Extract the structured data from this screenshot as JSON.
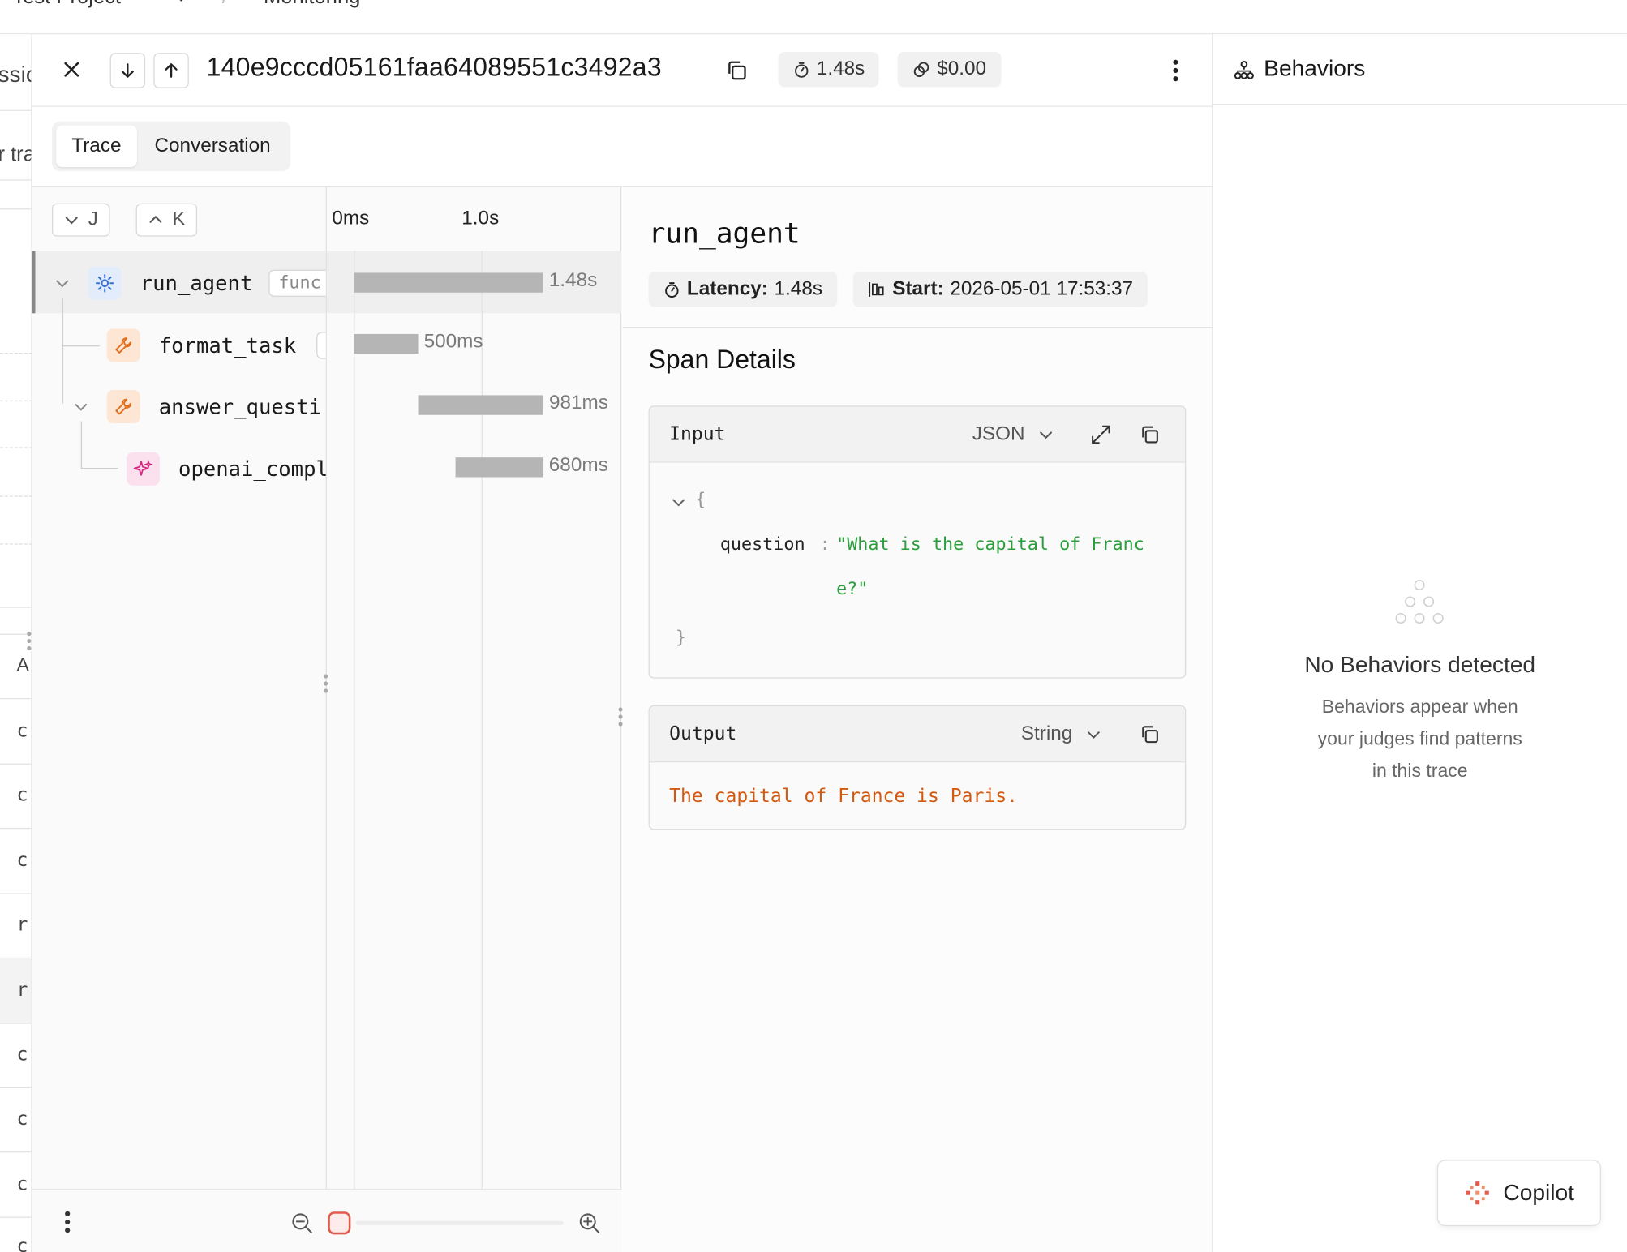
{
  "topbar": {
    "project": "Test Project",
    "separator": "/",
    "page": "Monitoring"
  },
  "left_strip": {
    "fragments": [
      "ssic",
      "r tra",
      "A",
      "c",
      "c",
      "c",
      "r",
      "r",
      "c",
      "c",
      "c",
      "c"
    ]
  },
  "header": {
    "trace_id": "140e9cccd05161faa64089551c3492a3",
    "latency_chip": "1.48s",
    "cost_chip": "$0.00",
    "icons": {
      "close": "close-icon",
      "down": "arrow-down-icon",
      "up": "arrow-up-icon",
      "copy": "copy-icon",
      "more": "more-vertical-icon"
    }
  },
  "tabs": [
    "Trace",
    "Conversation"
  ],
  "tree": {
    "next_key": "J",
    "prev_key": "K",
    "nodes": [
      {
        "name": "run_agent",
        "tag": "func",
        "icon": "gear-icon",
        "duration": "1.48s"
      },
      {
        "name": "format_task",
        "icon": "wrench-icon",
        "duration": "500ms"
      },
      {
        "name": "answer_questi",
        "icon": "wrench-icon",
        "duration": "981ms"
      },
      {
        "name": "openai_compl",
        "icon": "sparkle-icon",
        "duration": "680ms"
      }
    ]
  },
  "timeline": {
    "ticks": [
      "0ms",
      "1.0s"
    ],
    "total_s": 1.48,
    "spans": [
      {
        "start_s": 0.0,
        "duration_s": 1.48
      },
      {
        "start_s": 0.0,
        "duration_s": 0.5
      },
      {
        "start_s": 0.5,
        "duration_s": 0.981
      },
      {
        "start_s": 0.8,
        "duration_s": 0.68
      }
    ]
  },
  "detail": {
    "span_name": "run_agent",
    "latency_label": "Latency:",
    "latency_value": "1.48s",
    "start_label": "Start:",
    "start_value": "2026-05-01 17:53:37",
    "section_title": "Span Details",
    "input": {
      "label": "Input",
      "format": "JSON",
      "open_brace": "{",
      "close_brace": "}",
      "key": "question",
      "colon": ":",
      "value_line1": "\"What is the capital of Franc",
      "value_line2": "e?\""
    },
    "output": {
      "label": "Output",
      "format": "String",
      "value": "The capital of France is Paris."
    }
  },
  "behaviors": {
    "title": "Behaviors",
    "empty_title": "No Behaviors detected",
    "empty_body_1": "Behaviors appear when",
    "empty_body_2": "your judges find patterns",
    "empty_body_3": "in this trace"
  },
  "copilot": {
    "label": "Copilot"
  },
  "colors": {
    "accent": "#e35b4b",
    "json_string": "#2a9d3c",
    "output_text": "#d2590f",
    "bar": "#b5b5b5"
  }
}
